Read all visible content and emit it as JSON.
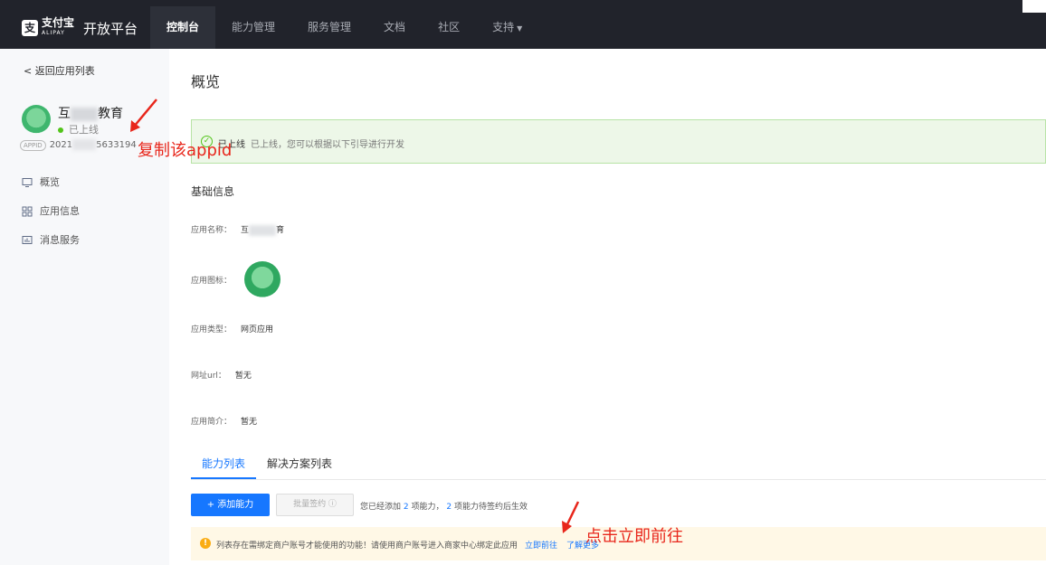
{
  "header": {
    "logo_mark": "支",
    "logo_brand": "支付宝",
    "logo_brand_en": "ALIPAY",
    "platform_title": "开放平台",
    "nav": [
      {
        "label": "控制台",
        "active": true
      },
      {
        "label": "能力管理",
        "active": false
      },
      {
        "label": "服务管理",
        "active": false
      },
      {
        "label": "文档",
        "active": false
      },
      {
        "label": "社区",
        "active": false
      },
      {
        "label": "支持",
        "active": false,
        "has_dropdown": true
      }
    ]
  },
  "sidebar": {
    "back_label": "< 返回应用列表",
    "app_name_prefix": "互",
    "app_name_suffix": "教育",
    "app_status": "已上线",
    "appid_badge": "APPID",
    "appid_prefix": "2021",
    "appid_suffix": "5633194",
    "menu": [
      {
        "icon": "monitor-icon",
        "label": "概览"
      },
      {
        "icon": "grid-icon",
        "label": "应用信息"
      },
      {
        "icon": "chart-icon",
        "label": "消息服务"
      }
    ]
  },
  "main": {
    "page_title": "概览",
    "success_title": "已上线",
    "success_desc": "已上线，您可以根据以下引导进行开发",
    "section_title": "基础信息",
    "fields": {
      "name_label": "应用名称：",
      "name_value_prefix": "互",
      "name_value_suffix": "育",
      "icon_label": "应用图标：",
      "type_label": "应用类型：",
      "type_value": "网页应用",
      "url_label": "网址url：",
      "url_value": "暂无",
      "intro_label": "应用简介：",
      "intro_value": "暂无"
    },
    "tabs": [
      {
        "label": "能力列表",
        "active": true
      },
      {
        "label": "解决方案列表",
        "active": false
      }
    ],
    "add_button": "+ 添加能力",
    "batch_button": "批量签约 ⓘ",
    "ability_text_1": "您已经添加",
    "ability_added": "2",
    "ability_text_2": "项能力，",
    "ability_pending": "2",
    "ability_text_3": "项能力待签约后生效",
    "warn_text": "列表存在需绑定商户账号才能使用的功能！请使用商户账号进入商家中心绑定此应用",
    "warn_link": "立即前往",
    "warn_more": "了解更多"
  },
  "annotations": {
    "copy_appid": "复制该appid",
    "click_go": "点击立即前往",
    "color": "#e8261b"
  }
}
